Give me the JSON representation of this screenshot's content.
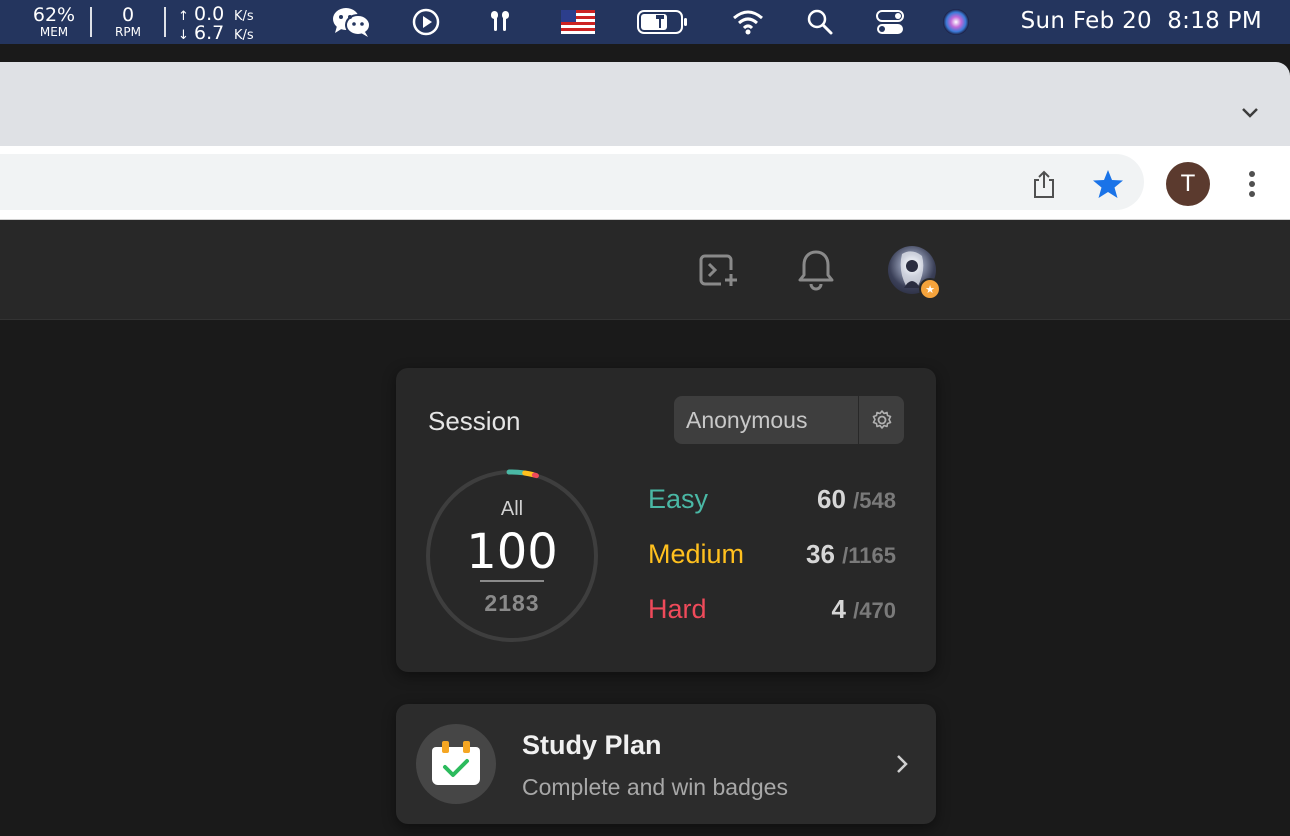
{
  "menubar": {
    "mem_value": "62%",
    "mem_label": "MEM",
    "rpm_value": "0",
    "rpm_label": "RPM",
    "net_up_arrow": "↑",
    "net_up_value": "0.0",
    "net_up_unit": "K/s",
    "net_down_arrow": "↓",
    "net_down_value": "6.7",
    "net_down_unit": "K/s",
    "icons": [
      "wechat-icon",
      "play-icon",
      "airpods-icon",
      "us-flag-icon",
      "battery-charging-icon",
      "wifi-icon",
      "search-icon",
      "control-center-icon",
      "siri-icon"
    ],
    "clock": "Sun Feb 20  8:18 PM"
  },
  "browser": {
    "profile_initial": "T",
    "bookmark_starred": true,
    "star_color": "#1a73e8"
  },
  "nav": {
    "icons": [
      "new-playground-icon",
      "bell-icon",
      "user-avatar",
      "premium-star-icon"
    ]
  },
  "session_card": {
    "title": "Session",
    "session_name": "Anonymous",
    "all_label": "All",
    "solved_total": "100",
    "question_total": "2183",
    "difficulties": [
      {
        "name": "Easy",
        "solved": "60",
        "total": "/548",
        "color": "#2cbb5d"
      },
      {
        "name": "Medium",
        "solved": "36",
        "total": "/1165",
        "color": "#ffc01e"
      },
      {
        "name": "Hard",
        "solved": "4",
        "total": "/470",
        "color": "#ef4743"
      }
    ]
  },
  "study_plan": {
    "title": "Study Plan",
    "subtitle": "Complete and win badges"
  },
  "colors": {
    "menubar_bg": "#24355e",
    "easy": "#4ab8a5",
    "medium": "#ffc01e",
    "hard": "#ef4a5a",
    "page_bg": "#1a1a1a",
    "card_bg": "#282828"
  }
}
